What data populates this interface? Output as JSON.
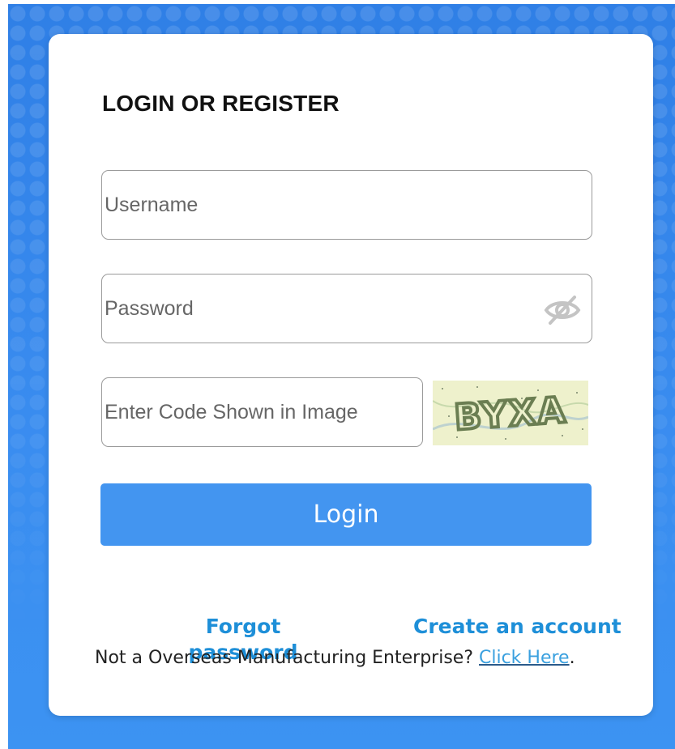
{
  "form": {
    "title": "LOGIN OR REGISTER",
    "username_placeholder": "Username",
    "password_placeholder": "Password",
    "captcha_placeholder": "Enter Code Shown in Image",
    "captcha_text": "BYXA",
    "login_label": "Login"
  },
  "links": {
    "forgot_password": "Forgot password",
    "create_account": "Create an account"
  },
  "footer": {
    "prefix": "Not a Overseas Manufacturing Enterprise? ",
    "link": "Click Here",
    "suffix": "."
  },
  "icons": {
    "password_toggle": "eye-slash-icon"
  },
  "colors": {
    "background": "#3a8df0",
    "button": "#4395f0",
    "link": "#1e8fd8",
    "footer_link": "#3aa0df"
  }
}
